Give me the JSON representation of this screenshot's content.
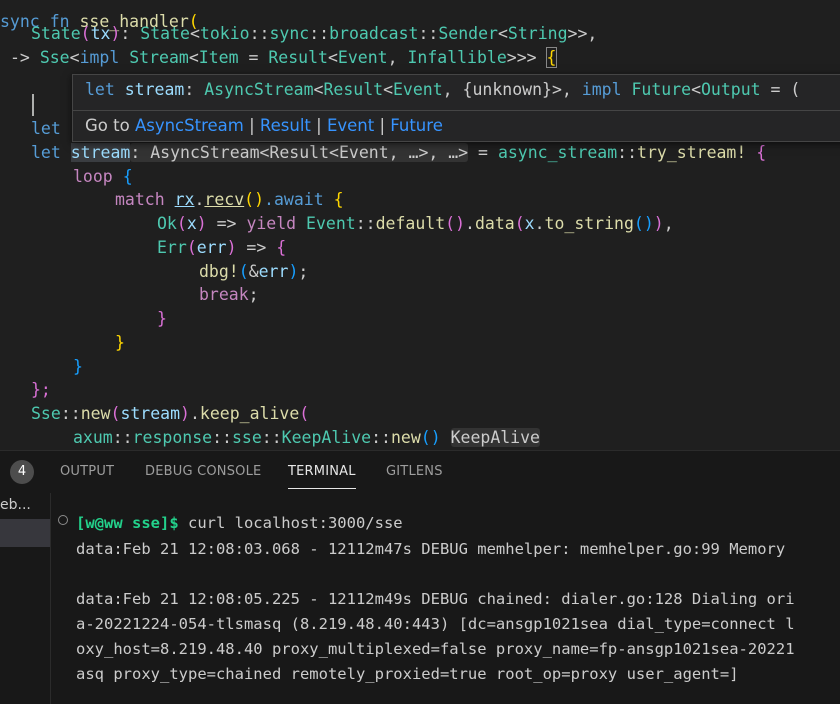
{
  "editor": {
    "code": {
      "l1": {
        "kw": "sync",
        "fn_kw": "fn",
        "name": "sse_handler",
        "paren": "("
      },
      "l2": {
        "State": "State",
        "tx": "tx",
        "colon": ":",
        "type": "State",
        "lt1": "<",
        "tokio": "tokio",
        "sep1": "::",
        "sync": "sync",
        "sep2": "::",
        "broadcast": "broadcast",
        "sep3": "::",
        "Sender": "Sender",
        "lt2": "<",
        "String": "String",
        "tail": ">>,"
      },
      "l3": {
        "arrow": "-> ",
        "Sse": "Sse",
        "lt": "<",
        "impl": "impl",
        "Stream": "Stream",
        "lt2": "<",
        "Item": "Item",
        "eq": " = ",
        "Result": "Result",
        "lt3": "<",
        "Event": "Event",
        "comma": ", ",
        "Infallible": "Infallible",
        "close": ">>> ",
        "brace": "{"
      },
      "l5": {
        "let": "let"
      },
      "l6": {
        "let": "let",
        "stream": "stream",
        "hint": ": AsyncStream<Result<Event, …>, …>",
        "eq": " = ",
        "mod": "async_stream",
        "sep": "::",
        "mac": "try_stream!",
        "brace": "{"
      },
      "l7": {
        "loop": "loop",
        "brace": "{"
      },
      "l8": {
        "match": "match",
        "rx": "rx",
        "dot": ".",
        "recv": "recv",
        "paren": "()",
        "await": ".await",
        "brace": "{"
      },
      "l9": {
        "Ok": "Ok",
        "x": "x",
        "arrow": " => ",
        "yield": "yield",
        "Event": "Event",
        "sep": "::",
        "default": "default",
        "p": "()",
        "dot": ".",
        "data": "data",
        "x2": "x",
        "dot2": ".",
        "to_string": "to_string",
        "p2": "()",
        "end": "),"
      },
      "l10": {
        "Err": "Err",
        "err": "err",
        "arrow": " => ",
        "brace": "{"
      },
      "l11": {
        "dbg": "dbg!",
        "amp": "&",
        "err": "err",
        "end": ");"
      },
      "l12": {
        "brk": "break",
        "semi": ";"
      },
      "l13": {
        "brace": "}"
      },
      "l14": {
        "brace": "}"
      },
      "l15": {
        "brace": "}"
      },
      "l16": {
        "brace": "};"
      },
      "l17": {
        "Sse": "Sse",
        "sep": "::",
        "new": "new",
        "stream": "stream",
        "dot": ".",
        "keep_alive": "keep_alive",
        "paren": "("
      },
      "l18": {
        "axum": "axum",
        "s1": "::",
        "response": "response",
        "s2": "::",
        "sse": "sse",
        "s3": "::",
        "KeepAlive": "KeepAlive",
        "s4": "::",
        "new": "new",
        "p": "()",
        "hint": "KeepAlive"
      }
    },
    "hover": {
      "sig": {
        "let": "let",
        "name": "stream",
        "colon": ": ",
        "AsyncStream": "AsyncStream",
        "lt": "<",
        "Result": "Result",
        "lt2": "<",
        "Event": "Event",
        "comma": ", ",
        "unknown": "{unknown}",
        "gt": ">",
        "comma2": ", ",
        "impl": "impl",
        "Future": "Future",
        "lt3": "<",
        "Output": "Output",
        "eq": " = ("
      },
      "go_to": "Go to",
      "links": [
        "AsyncStream",
        "Result",
        "Event",
        "Future"
      ],
      "sep": " | "
    }
  },
  "panel": {
    "badge": "4",
    "tabs": [
      "OUTPUT",
      "DEBUG CONSOLE",
      "TERMINAL",
      "GITLENS"
    ],
    "active_tab": "TERMINAL",
    "side_label": "eb..."
  },
  "terminal": {
    "prompt": "[w@ww sse]$",
    "command": " curl localhost:3000/sse",
    "lines": [
      "data:Feb 21 12:08:03.068 - 12112m47s DEBUG memhelper: memhelper.go:99 Memory",
      "",
      "data:Feb 21 12:08:05.225 - 12112m49s DEBUG chained: dialer.go:128 Dialing ori",
      "a-20221224-054-tlsmasq (8.219.48.40:443) [dc=ansgp1021sea dial_type=connect l",
      "oxy_host=8.219.48.40 proxy_multiplexed=false proxy_name=fp-ansgp1021sea-20221",
      "asq proxy_type=chained remotely_proxied=true root_op=proxy user_agent=]"
    ]
  },
  "colors": {
    "keyword": "#569cd6",
    "control": "#c586c0",
    "type": "#4ec9b0",
    "function": "#dcdcaa",
    "variable": "#9cdcfe",
    "bracket_1": "#ffd700",
    "bracket_2": "#da70d6",
    "bracket_3": "#179fff",
    "link": "#3794ff",
    "prompt": "#23d18b"
  }
}
